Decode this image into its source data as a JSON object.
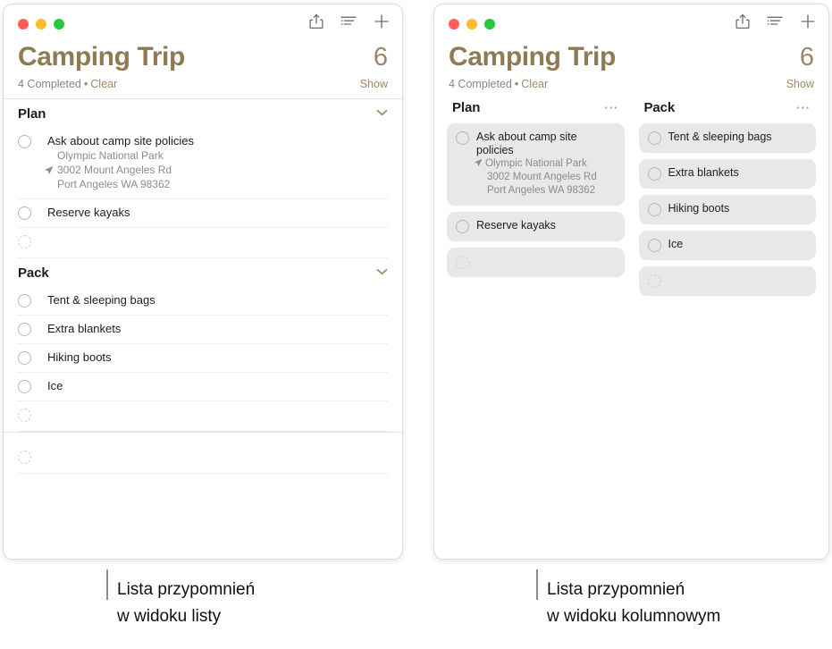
{
  "window_list": {
    "titlebar": {
      "traffic_lights": [
        {
          "name": "close",
          "color": "#ff5f57"
        },
        {
          "name": "minimize",
          "color": "#febc2e"
        },
        {
          "name": "zoom",
          "color": "#28c840"
        }
      ],
      "actions": [
        {
          "name": "share-icon",
          "label": "Share"
        },
        {
          "name": "list-view-icon",
          "label": "View Options"
        },
        {
          "name": "add-icon",
          "label": "Add Reminder"
        }
      ]
    },
    "header": {
      "title": "Camping Trip",
      "count": "6",
      "completed": "4 Completed",
      "separator": "•",
      "clear": "Clear",
      "show": "Show"
    },
    "sections": [
      {
        "title": "Plan",
        "chevron": "⌄",
        "items": [
          {
            "title": "Ask about camp site policies",
            "sub": [
              "Olympic National Park",
              "3002 Mount Angeles Rd",
              "Port Angeles WA 98362"
            ],
            "location_icon_line": 1,
            "checked": false
          },
          {
            "title": "Reserve kayaks",
            "sub": [],
            "checked": false
          },
          {
            "title": "",
            "sub": [],
            "checked": false,
            "placeholder": true
          }
        ]
      },
      {
        "title": "Pack",
        "chevron": "⌄",
        "items": [
          {
            "title": "Tent & sleeping bags",
            "sub": [],
            "checked": false
          },
          {
            "title": "Extra blankets",
            "sub": [],
            "checked": false
          },
          {
            "title": "Hiking boots",
            "sub": [],
            "checked": false
          },
          {
            "title": "Ice",
            "sub": [],
            "checked": false
          },
          {
            "title": "",
            "sub": [],
            "checked": false,
            "placeholder": true
          }
        ]
      },
      {
        "title": "",
        "items": [
          {
            "title": "",
            "sub": [],
            "checked": false,
            "placeholder": true
          }
        ]
      }
    ]
  },
  "window_columns": {
    "titlebar": {
      "traffic_lights": [
        {
          "name": "close",
          "color": "#ff5f57"
        },
        {
          "name": "minimize",
          "color": "#febc2e"
        },
        {
          "name": "zoom",
          "color": "#28c840"
        }
      ],
      "actions": [
        {
          "name": "share-icon",
          "label": "Share"
        },
        {
          "name": "list-view-icon",
          "label": "View Options"
        },
        {
          "name": "add-icon",
          "label": "Add Reminder"
        }
      ]
    },
    "header": {
      "title": "Camping Trip",
      "count": "6",
      "completed": "4 Completed",
      "separator": "•",
      "clear": "Clear",
      "show": "Show"
    },
    "columns": [
      {
        "title": "Plan",
        "more": "···",
        "cards": [
          {
            "title": "Ask about camp site policies",
            "sub": [
              "Olympic National Park",
              "3002 Mount Angeles Rd",
              "Port Angeles WA 98362"
            ],
            "location_icon_line": 0,
            "checked": false
          },
          {
            "title": "Reserve kayaks",
            "sub": [],
            "checked": false
          },
          {
            "title": "",
            "sub": [],
            "checked": false,
            "placeholder": true
          }
        ]
      },
      {
        "title": "Pack",
        "more": "···",
        "cards": [
          {
            "title": "Tent & sleeping bags",
            "sub": [],
            "checked": false
          },
          {
            "title": "Extra blankets",
            "sub": [],
            "checked": false
          },
          {
            "title": "Hiking boots",
            "sub": [],
            "checked": false
          },
          {
            "title": "Ice",
            "sub": [],
            "checked": false
          },
          {
            "title": "",
            "sub": [],
            "checked": false,
            "placeholder": true
          }
        ]
      }
    ]
  },
  "captions": {
    "list": "Lista przypomnień\nw widoku listy",
    "columns": "Lista przypomnień\nw widoku kolumnowym"
  },
  "colors": {
    "accent": "#907a54",
    "link": "#a08a64",
    "card_bg": "#e8e8e8",
    "muted_text": "#8b8b90"
  }
}
